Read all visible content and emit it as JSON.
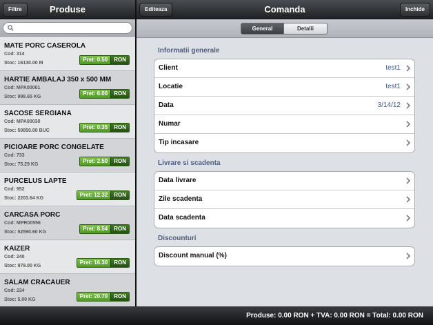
{
  "left": {
    "title": "Produse",
    "filter_label": "Filtre",
    "search": {
      "placeholder": "",
      "value": ""
    },
    "products": [
      {
        "name": "MATE PORC CASEROLA",
        "code": "Cod: 314",
        "stock": "Stoc: 16130.00 M",
        "price": "Pret: 0.50",
        "currency": "RON"
      },
      {
        "name": "HARTIE AMBALAJ 350 x 500 MM",
        "code": "Cod: MPA00001",
        "stock": "Stoc: 998.65 KG",
        "price": "Pret: 6.00",
        "currency": "RON"
      },
      {
        "name": "SACOSE SERGIANA",
        "code": "Cod: MPA00030",
        "stock": "Stoc: 50850.00 BUC",
        "price": "Pret: 0.35",
        "currency": "RON"
      },
      {
        "name": "PICIOARE PORC CONGELATE",
        "code": "Cod: 733",
        "stock": "Stoc: 75.29 KG",
        "price": "Pret: 2.50",
        "currency": "RON"
      },
      {
        "name": "PURCELUS LAPTE",
        "code": "Cod: 952",
        "stock": "Stoc: 2203.64 KG",
        "price": "Pret: 12.32",
        "currency": "RON"
      },
      {
        "name": "CARCASA PORC",
        "code": "Cod: MPR00556",
        "stock": "Stoc: 52590.60 KG",
        "price": "Pret: 8.54",
        "currency": "RON"
      },
      {
        "name": "KAIZER",
        "code": "Cod: 240",
        "stock": "Stoc: 979.00 KG",
        "price": "Pret: 16.30",
        "currency": "RON"
      },
      {
        "name": "SALAM CRACAUER",
        "code": "Cod: 234",
        "stock": "Stoc: 5.00 KG",
        "price": "Pret: 20.70",
        "currency": "RON"
      }
    ]
  },
  "right": {
    "title": "Comanda",
    "edit_label": "Editeaza",
    "close_label": "Inchide",
    "tabs": [
      {
        "label": "General",
        "active": true
      },
      {
        "label": "Detalii",
        "active": false
      }
    ],
    "sections": [
      {
        "title": "Informatii generale",
        "rows": [
          {
            "label": "Client",
            "value": "test1"
          },
          {
            "label": "Locatie",
            "value": "test1"
          },
          {
            "label": "Data",
            "value": "3/14/12"
          },
          {
            "label": "Numar",
            "value": ""
          },
          {
            "label": "Tip incasare",
            "value": ""
          }
        ]
      },
      {
        "title": "Livrare si scadenta",
        "rows": [
          {
            "label": "Data livrare",
            "value": ""
          },
          {
            "label": "Zile scadenta",
            "value": ""
          },
          {
            "label": "Data scadenta",
            "value": ""
          }
        ]
      },
      {
        "title": "Discounturi",
        "rows": [
          {
            "label": "Discount manual (%)",
            "value": ""
          }
        ]
      }
    ]
  },
  "footer": {
    "totals": "Produse: 0.00 RON + TVA: 0.00 RON = Total: 0.00 RON"
  },
  "colors": {
    "accent_green": "#4f9a24",
    "section_title": "#4e5f80",
    "value_blue": "#3a5a8c"
  },
  "icons": {
    "search": "search-icon",
    "chevron": "chevron-right-icon"
  }
}
